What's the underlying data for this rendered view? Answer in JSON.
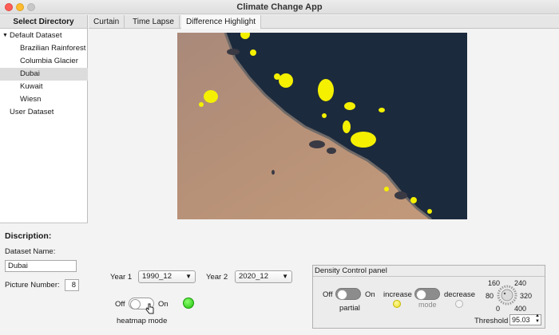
{
  "window": {
    "title": "Climate Change App"
  },
  "sidebar": {
    "header": "Select Directory",
    "items": [
      {
        "label": "Default Dataset",
        "expanded": true
      },
      {
        "label": "Brazilian Rainforest"
      },
      {
        "label": "Columbia Glacier"
      },
      {
        "label": "Dubai",
        "selected": true
      },
      {
        "label": "Kuwait"
      },
      {
        "label": "Wiesn"
      },
      {
        "label": "User Dataset"
      }
    ]
  },
  "description": {
    "title": "Discription:",
    "dataset_name_label": "Dataset Name:",
    "dataset_name_value": "Dubai",
    "picture_number_label": "Picture Number:",
    "picture_number_value": "8"
  },
  "tabs": [
    {
      "label": "Curtain"
    },
    {
      "label": "Time Lapse"
    },
    {
      "label": "Difference Highlight",
      "active": true
    }
  ],
  "controls": {
    "year1_label": "Year 1",
    "year1_value": "1990_12",
    "year2_label": "Year 2",
    "year2_value": "2020_12",
    "heatmap_off": "Off",
    "heatmap_on": "On",
    "heatmap_label": "heatmap mode",
    "heatmap_state": "off",
    "heatmap_lamp_color": "#2ecc1a"
  },
  "density_panel": {
    "title": "Density Control panel",
    "partial_off": "Off",
    "partial_on": "On",
    "partial_label": "partial",
    "mode_increase": "increase",
    "mode_decrease": "decrease",
    "mode_label": "mode",
    "increase_lamp_color": "#f5e63a",
    "decrease_lamp_color": "#f0f0f0",
    "knob_ticks": [
      "160",
      "240",
      "80",
      "320",
      "0",
      "400"
    ],
    "threshold_label": "Threshold",
    "threshold_value": "95.03"
  },
  "colors": {
    "highlight": "#f4f000",
    "sea": "#1c2a3d",
    "desert": "#b08a70"
  }
}
